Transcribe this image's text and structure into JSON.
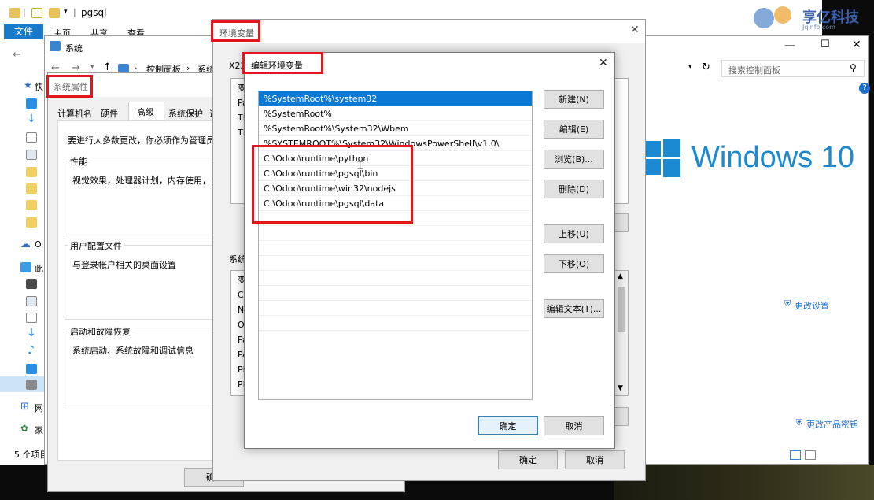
{
  "explorer": {
    "title": "pgsql",
    "ribbon_file": "文件",
    "ribbon_home": "主页",
    "ribbon_share": "共享",
    "ribbon_view": "查看",
    "status": "5 个项目",
    "nav_items": [
      "快",
      "",
      "",
      "",
      "",
      "",
      "",
      "",
      "O",
      "此",
      "",
      "",
      "",
      "",
      "",
      "",
      "",
      "网",
      "家"
    ]
  },
  "control_panel": {
    "window_title": "系统",
    "breadcrumb_root": "控制面板",
    "breadcrumb_sub": "系统",
    "search_placeholder": "搜索控制面板",
    "windows_brand": "Windows 10",
    "change_settings": "更改设置",
    "change_product_key": "更改产品密钥"
  },
  "system_properties": {
    "title": "系统属性",
    "tabs": [
      "计算机名",
      "硬件",
      "高级",
      "系统保护",
      "远"
    ],
    "intro": "要进行大多数更改，你必须作为管理员登录。",
    "performance_label": "性能",
    "performance_desc": "视觉效果，处理器计划，内存使用，以及虚拟内存",
    "profile_label": "用户配置文件",
    "profile_desc": "与登录帐户相关的桌面设置",
    "startup_label": "启动和故障恢复",
    "startup_desc": "系统启动、系统故障和调试信息",
    "ok": "确定"
  },
  "env_vars": {
    "title": "环境变量",
    "user_vars_label": "X22",
    "user_rows": [
      "变",
      "Pa",
      "TE",
      "TM"
    ],
    "system_vars_label": "系统",
    "system_rows": [
      "变",
      "Co",
      "NU",
      "OS",
      "Pa",
      "PA",
      "PR",
      "PR"
    ],
    "ok": "确定",
    "cancel": "取消"
  },
  "edit_env": {
    "title": "编辑环境变量",
    "paths": [
      "%SystemRoot%\\system32",
      "%SystemRoot%",
      "%SystemRoot%\\System32\\Wbem",
      "%SYSTEMROOT%\\System32\\WindowsPowerShell\\v1.0\\",
      "C:\\Odoo\\runtime\\python",
      "C:\\Odoo\\runtime\\pgsql\\bin",
      "C:\\Odoo\\runtime\\win32\\nodejs",
      "C:\\Odoo\\runtime\\pgsql\\data"
    ],
    "btn_new": "新建(N)",
    "btn_edit": "编辑(E)",
    "btn_browse": "浏览(B)...",
    "btn_delete": "删除(D)",
    "btn_up": "上移(U)",
    "btn_down": "下移(O)",
    "btn_edit_text": "编辑文本(T)...",
    "ok": "确定",
    "cancel": "取消"
  },
  "watermark": {
    "text": "享亿科技",
    "sub": "Jqinfo.com"
  },
  "colors": {
    "accent": "#0a79d6",
    "highlight": "#e2161d",
    "windows_blue": "#1b8ad3"
  }
}
